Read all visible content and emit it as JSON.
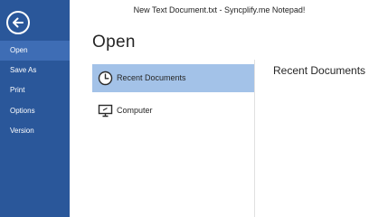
{
  "window": {
    "title": "New Text Document.txt - Syncplify.me Notepad!"
  },
  "sidebar": {
    "back_icon": "back-arrow-icon",
    "items": [
      {
        "label": "Open",
        "active": true
      },
      {
        "label": "Save As",
        "active": false
      },
      {
        "label": "Print",
        "active": false
      },
      {
        "label": "Options",
        "active": false
      },
      {
        "label": "Version",
        "active": false
      }
    ]
  },
  "main": {
    "heading": "Open",
    "places": [
      {
        "label": "Recent Documents",
        "icon": "clock-icon",
        "selected": true
      },
      {
        "label": "Computer",
        "icon": "monitor-icon",
        "selected": false
      }
    ],
    "panel_title": "Recent Documents"
  },
  "colors": {
    "sidebar_bg": "#2a579a",
    "sidebar_active": "#3e6db5",
    "selected_place": "#a3c2e8"
  }
}
